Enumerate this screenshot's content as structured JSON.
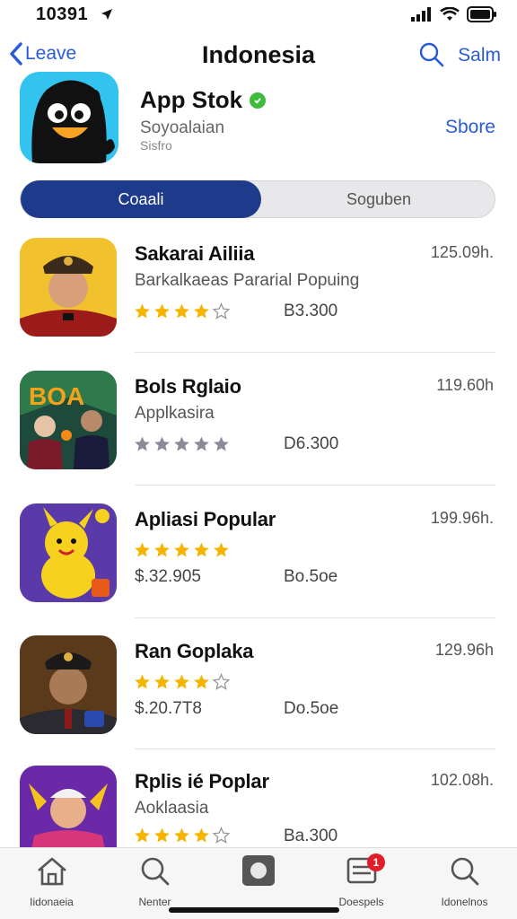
{
  "status": {
    "time": "10391"
  },
  "nav": {
    "back_label": "Leave",
    "title": "Indonesia",
    "action_label": "Salm"
  },
  "app": {
    "name": "App Stok",
    "subtitle": "Soyoalaian",
    "subtitle2": "Sisfro",
    "store_label": "Sbore"
  },
  "segments": [
    {
      "label": "Coaali",
      "selected": true
    },
    {
      "label": "Soguben",
      "selected": false
    }
  ],
  "list": [
    {
      "name": "Sakarai Ailiia",
      "subtitle": "Barkalkaeas Pararial Popuing",
      "price": "",
      "value": "B3.300",
      "size": "125.09h.",
      "rating": 4,
      "star_color": "#f4b400"
    },
    {
      "name": "Bols Rglaio",
      "subtitle": "Applkasira",
      "price": "",
      "value": "D6.300",
      "size": "119.60h",
      "rating": 5,
      "star_color": "#8a8a99"
    },
    {
      "name": "Apliasi Popular",
      "subtitle": "",
      "price": "$.32.905",
      "value": "Bo.5oe",
      "size": "199.96h.",
      "rating": 5,
      "star_color": "#f4b400"
    },
    {
      "name": "Ran Goplaka",
      "subtitle": "",
      "price": "$.20.7T8",
      "value": "Do.5oe",
      "size": "129.96h",
      "rating": 4,
      "star_color": "#f4b400"
    },
    {
      "name": "Rplis ié Poplar",
      "subtitle": "Aoklaasia",
      "price": "",
      "value": "Ba.300",
      "size": "102.08h.",
      "rating": 4,
      "star_color": "#f4b400"
    }
  ],
  "tabs": [
    {
      "label": "Iidonaeia",
      "icon": "home-icon"
    },
    {
      "label": "Nenter",
      "icon": "search-icon"
    },
    {
      "label": "",
      "icon": "app-store-icon"
    },
    {
      "label": "Doespels",
      "icon": "updates-icon",
      "badge": "1"
    },
    {
      "label": "Idonelnos",
      "icon": "search-icon"
    }
  ],
  "colors": {
    "accent": "#2a5bd7",
    "segment_active": "#1e3a8a",
    "badge": "#e11d2a",
    "star": "#f4b400"
  }
}
